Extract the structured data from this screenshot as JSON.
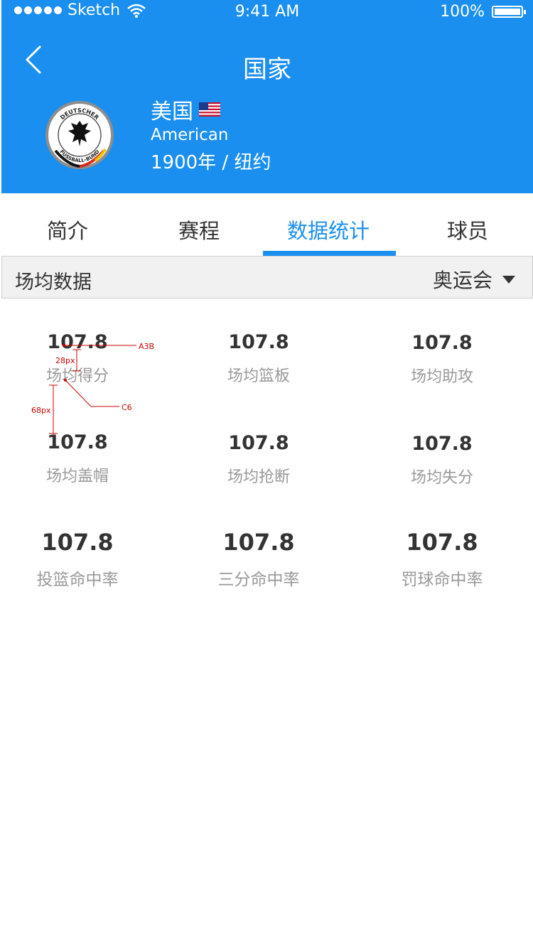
{
  "status_bar": {
    "carrier": "Sketch",
    "time": "9:41 AM",
    "battery": "100%"
  },
  "nav": {
    "title": "国家",
    "back_icon": "chevron-left-icon"
  },
  "team": {
    "name": "美国",
    "english_name": "American",
    "founded": "1900年 / 纽约",
    "logo_text_top": "DEUTSCHER",
    "logo_text_bottom": "FUSSBALL-BUND",
    "flag_icon": "us-flag-icon"
  },
  "tabs": [
    {
      "label": "简介",
      "active": false
    },
    {
      "label": "赛程",
      "active": false
    },
    {
      "label": "数据统计",
      "active": true
    },
    {
      "label": "球员",
      "active": false
    }
  ],
  "section": {
    "title": "场均数据",
    "filter_value": "奥运会"
  },
  "stats": [
    {
      "value": "107.8",
      "label": "场均得分"
    },
    {
      "value": "107.8",
      "label": "场均篮板"
    },
    {
      "value": "107.8",
      "label": "场均助攻"
    },
    {
      "value": "107.8",
      "label": "场均盖帽"
    },
    {
      "value": "107.8",
      "label": "场均抢断"
    },
    {
      "value": "107.8",
      "label": "场均失分"
    },
    {
      "value": "107.8",
      "label": "投篮命中率"
    },
    {
      "value": "107.8",
      "label": "三分命中率"
    },
    {
      "value": "107.8",
      "label": "罚球命中率"
    }
  ],
  "annotations": {
    "color_value": "A3B",
    "color_label": "C6",
    "spacing_1": "28px",
    "spacing_2": "68px"
  },
  "colors": {
    "primary": "#1a8fef",
    "text_dark": "#333333",
    "text_light": "#999999",
    "section_bg": "#f1f1f1"
  }
}
